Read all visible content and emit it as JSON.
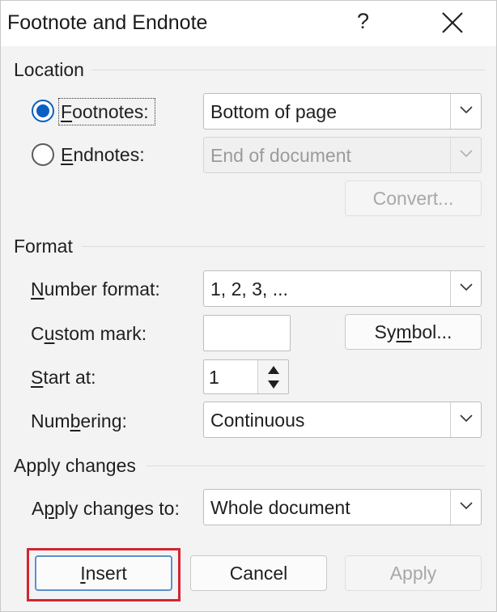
{
  "window": {
    "title": "Footnote and Endnote",
    "help": "?",
    "close": "✕"
  },
  "location": {
    "heading": "Location",
    "footnotes": {
      "label": "Footnotes:",
      "checked": true,
      "value": "Bottom of page"
    },
    "endnotes": {
      "label": "Endnotes:",
      "checked": false,
      "value": "End of document"
    },
    "convert_label": "Convert..."
  },
  "format": {
    "heading": "Format",
    "number_format": {
      "label": "Number format:",
      "value": "1, 2, 3, ..."
    },
    "custom_mark": {
      "label": "Custom mark:",
      "value": ""
    },
    "symbol_label": "Symbol...",
    "start_at": {
      "label": "Start at:",
      "value": "1"
    },
    "numbering": {
      "label": "Numbering:",
      "value": "Continuous"
    }
  },
  "apply_changes": {
    "heading": "Apply changes",
    "apply_to": {
      "label": "Apply changes to:",
      "value": "Whole document"
    }
  },
  "buttons": {
    "insert": "Insert",
    "cancel": "Cancel",
    "apply": "Apply"
  },
  "colors": {
    "accent": "#0a5fc2",
    "highlight": "#d3252f"
  }
}
